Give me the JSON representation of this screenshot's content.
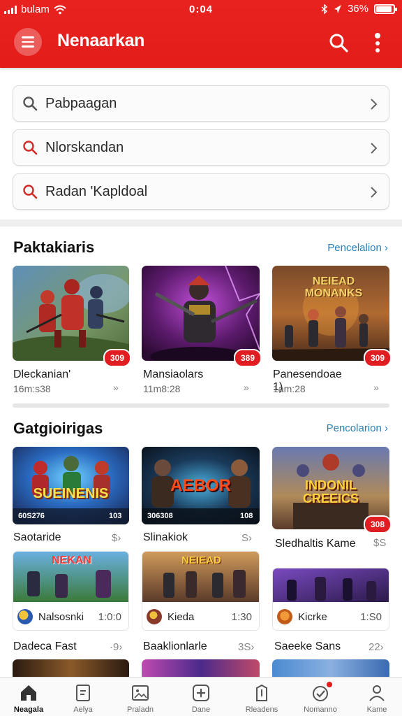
{
  "status_bar": {
    "carrier": "bulam",
    "time": "0:04",
    "battery": "36%"
  },
  "header": {
    "title": "Nenaarkan",
    "menu_icon": "hamburger-icon",
    "search_icon": "search-icon",
    "more_icon": "more-vertical-icon",
    "color": "#e31c1a"
  },
  "suggestions": [
    {
      "text": "Pabpaagan",
      "icon": "search-icon"
    },
    {
      "text": "Nlorskandan",
      "icon": "search-icon"
    },
    {
      "text": "Radan 'Kapldoal",
      "icon": "search-icon"
    }
  ],
  "section1": {
    "title": "Paktakiaris",
    "link": "Pencelalion ›",
    "cards": [
      {
        "title": "Dleckanian'",
        "sub": "16m:s38",
        "badge": "309",
        "chev": "»"
      },
      {
        "title": "Mansiaolars",
        "sub": "11m8:28",
        "badge": "389",
        "chev": "»"
      },
      {
        "title": "Panesendoae 1)",
        "sub": "1am:28",
        "badge": "309",
        "chev": "»",
        "overlay": "NEIEAD MONANKS"
      }
    ]
  },
  "section2": {
    "title": "Gatgioirigas",
    "link": "Pencolarion ›",
    "cards": [
      {
        "title": "Saotaride",
        "price": "$›",
        "overlay_left": "60S276",
        "overlay_right": "103",
        "banner": "SUEINENIS"
      },
      {
        "title": "Slinakiok",
        "price": "S›",
        "overlay_left": "306308",
        "overlay_right": "108",
        "banner": "AEBOR"
      },
      {
        "title": "Sledhaltis Kame",
        "price": "$S",
        "badge": "308",
        "banner": "INDONIL CREEICS"
      }
    ],
    "mini_cards": [
      {
        "name": "Nalsosnki",
        "time": "1:0:0",
        "banner": "NEKAN"
      },
      {
        "name": "Kieda",
        "time": "1:30",
        "banner": "NEIEAD"
      },
      {
        "name": "Kicrke",
        "time": "1:S0",
        "banner": ""
      }
    ],
    "row3": [
      {
        "title": "Dadeca Fast",
        "chev": "·9›"
      },
      {
        "title": "Baaklionlarle",
        "chev": "3S›"
      },
      {
        "title": "Saeeke Sans",
        "chev": "22›"
      }
    ]
  },
  "nav": [
    {
      "label": "Neagala",
      "icon": "home-icon",
      "active": true
    },
    {
      "label": "Aelya",
      "icon": "document-icon",
      "active": false
    },
    {
      "label": "Praladn",
      "icon": "gallery-icon",
      "active": false
    },
    {
      "label": "Dane",
      "icon": "plus-square-icon",
      "active": false
    },
    {
      "label": "Rleadens",
      "icon": "bookmark-icon",
      "active": false
    },
    {
      "label": "Nomanno",
      "icon": "check-circle-icon",
      "active": false
    },
    {
      "label": "Kame",
      "icon": "user-icon",
      "active": false
    }
  ]
}
